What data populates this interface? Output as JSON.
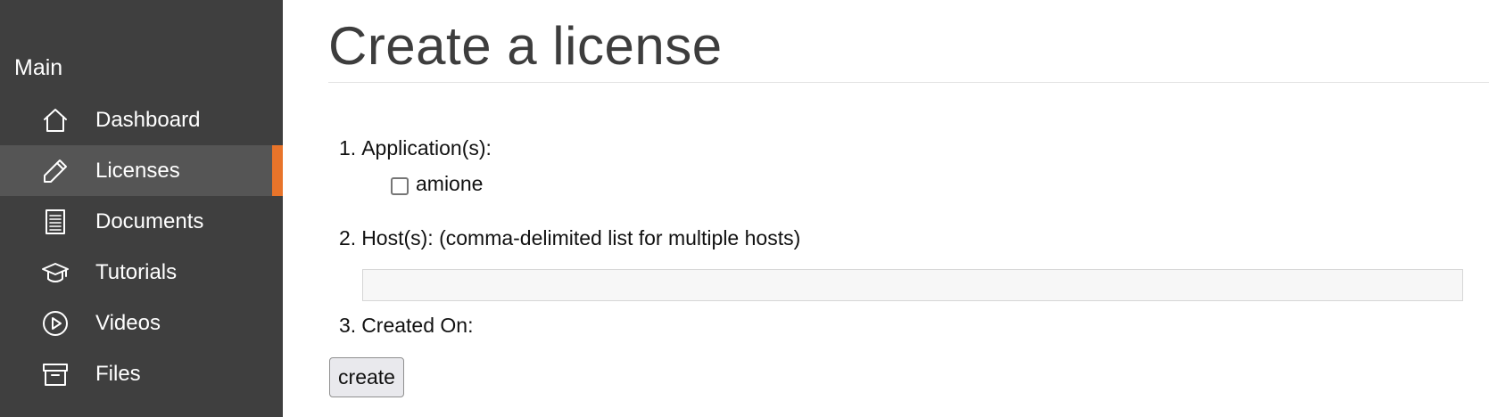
{
  "sidebar": {
    "heading": "Main",
    "items": [
      {
        "label": "Dashboard",
        "icon": "home-icon",
        "active": false
      },
      {
        "label": "Licenses",
        "icon": "pencil-icon",
        "active": true
      },
      {
        "label": "Documents",
        "icon": "document-icon",
        "active": false
      },
      {
        "label": "Tutorials",
        "icon": "graduation-cap-icon",
        "active": false
      },
      {
        "label": "Videos",
        "icon": "play-circle-icon",
        "active": false
      },
      {
        "label": "Files",
        "icon": "archive-box-icon",
        "active": false
      }
    ],
    "active_accent": "#e8742a",
    "background": "#3f3f3f",
    "active_background": "#555555"
  },
  "main": {
    "title": "Create a license",
    "fields": [
      {
        "number": "1.",
        "label": "Application(s):"
      },
      {
        "number": "2.",
        "label": "Host(s): (comma-delimited list for multiple hosts)"
      },
      {
        "number": "3.",
        "label": "Created On:"
      }
    ],
    "applications": [
      {
        "label": "amione",
        "checked": false
      }
    ],
    "hosts_input": {
      "value": "",
      "placeholder": ""
    },
    "create_button": "create"
  }
}
